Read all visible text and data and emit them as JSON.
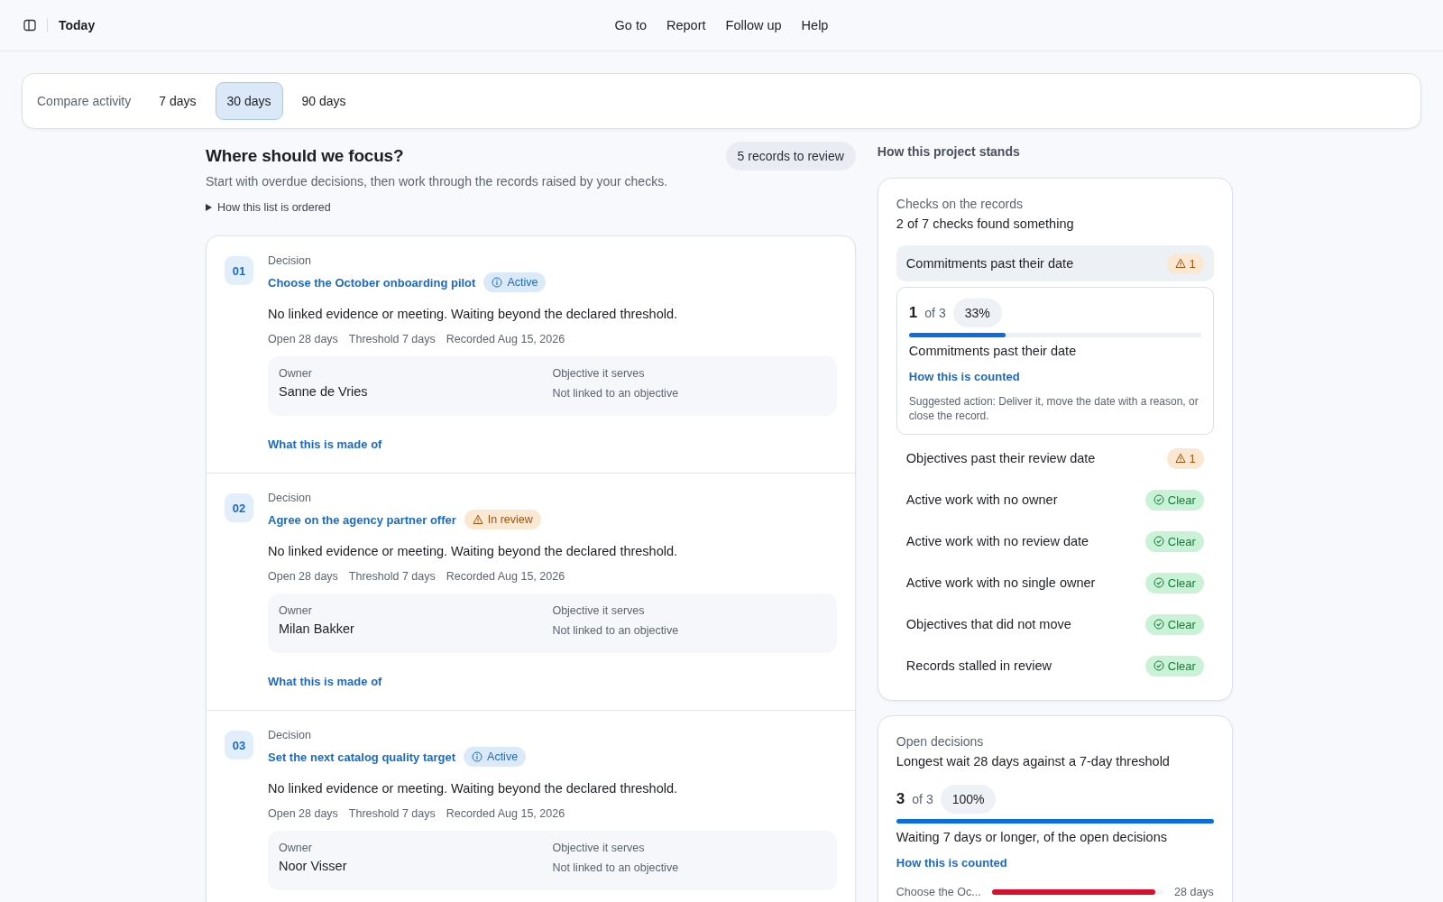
{
  "header": {
    "title": "Today",
    "nav": [
      "Go to",
      "Report",
      "Follow up",
      "Help"
    ]
  },
  "compare": {
    "label": "Compare activity",
    "options": [
      {
        "label": "7 days",
        "selected": false
      },
      {
        "label": "30 days",
        "selected": true
      },
      {
        "label": "90 days",
        "selected": false
      }
    ]
  },
  "focus": {
    "title": "Where should we focus?",
    "count_badge": "5 records to review",
    "subtitle": "Start with overdue decisions, then work through the records raised by your checks.",
    "disclosure": "How this list is ordered",
    "records": [
      {
        "number": "01",
        "type": "Decision",
        "title": "Choose the October onboarding pilot",
        "status": {
          "kind": "info",
          "label": "Active"
        },
        "summary": "No linked evidence or meeting. Waiting beyond the declared threshold.",
        "meta": [
          "Open 28 days",
          "Threshold 7 days",
          "Recorded Aug 15, 2026"
        ],
        "owner_label": "Owner",
        "owner": "Sanne de Vries",
        "objective_label": "Objective it serves",
        "objective": "Not linked to an objective",
        "link": "What this is made of"
      },
      {
        "number": "02",
        "type": "Decision",
        "title": "Agree on the agency partner offer",
        "status": {
          "kind": "warning",
          "label": "In review"
        },
        "summary": "No linked evidence or meeting. Waiting beyond the declared threshold.",
        "meta": [
          "Open 28 days",
          "Threshold 7 days",
          "Recorded Aug 15, 2026"
        ],
        "owner_label": "Owner",
        "owner": "Milan Bakker",
        "objective_label": "Objective it serves",
        "objective": "Not linked to an objective",
        "link": "What this is made of"
      },
      {
        "number": "03",
        "type": "Decision",
        "title": "Set the next catalog quality target",
        "status": {
          "kind": "info",
          "label": "Active"
        },
        "summary": "No linked evidence or meeting. Waiting beyond the declared threshold.",
        "meta": [
          "Open 28 days",
          "Threshold 7 days",
          "Recorded Aug 15, 2026"
        ],
        "owner_label": "Owner",
        "owner": "Noor Visser",
        "objective_label": "Objective it serves",
        "objective": "Not linked to an objective"
      }
    ]
  },
  "standing": {
    "title": "How this project stands",
    "checks": {
      "label": "Checks on the records",
      "summary": "2 of 7 checks found something",
      "items": [
        {
          "label": "Commitments past their date",
          "kind": "warning",
          "badge": "1",
          "selected": true,
          "detail": {
            "count": "1",
            "of": "of 3",
            "percent": "33%",
            "level": 0.33,
            "caption": "Commitments past their date",
            "link": "How this is counted",
            "note": "Suggested action: Deliver it, move the date with a reason, or close the record."
          }
        },
        {
          "label": "Objectives past their review date",
          "kind": "warning",
          "badge": "1",
          "selected": false
        },
        {
          "label": "Active work with no owner",
          "kind": "clear",
          "badge": "Clear",
          "selected": false
        },
        {
          "label": "Active work with no review date",
          "kind": "clear",
          "badge": "Clear",
          "selected": false
        },
        {
          "label": "Active work with no single owner",
          "kind": "clear",
          "badge": "Clear",
          "selected": false
        },
        {
          "label": "Objectives that did not move",
          "kind": "clear",
          "badge": "Clear",
          "selected": false
        },
        {
          "label": "Records stalled in review",
          "kind": "clear",
          "badge": "Clear",
          "selected": false
        }
      ]
    },
    "open_decisions": {
      "label": "Open decisions",
      "summary": "Longest wait 28 days against a 7-day threshold",
      "count": "3",
      "of": "of 3",
      "percent": "100%",
      "level": 1,
      "caption": "Waiting 7 days or longer, of the open decisions",
      "link": "How this is counted",
      "waits": [
        {
          "label": "Choose the Oc...",
          "level": 0.95,
          "value": "28 days"
        }
      ]
    }
  }
}
